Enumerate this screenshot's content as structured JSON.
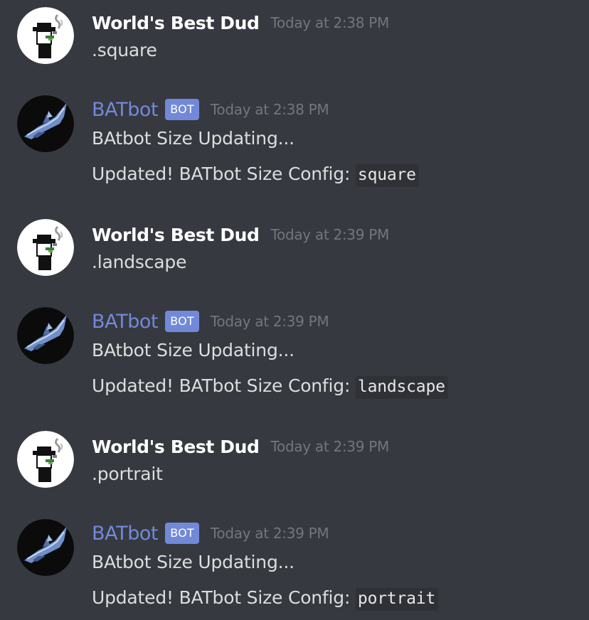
{
  "messages": [
    {
      "author": "World's Best Dud",
      "is_bot": false,
      "avatar_icon": "hat-smoker-avatar",
      "timestamp": "Today at 2:38 PM",
      "lines": [
        ".square"
      ]
    },
    {
      "author": "BATbot",
      "is_bot": true,
      "bot_tag": "BOT",
      "avatar_icon": "bat-avatar",
      "timestamp": "Today at 2:38 PM",
      "lines": [
        "BAtbot Size Updating..."
      ],
      "config_prefix": "Updated! BATbot Size Config: ",
      "config_value": "square"
    },
    {
      "author": "World's Best Dud",
      "is_bot": false,
      "avatar_icon": "hat-smoker-avatar",
      "timestamp": "Today at 2:39 PM",
      "lines": [
        ".landscape"
      ]
    },
    {
      "author": "BATbot",
      "is_bot": true,
      "bot_tag": "BOT",
      "avatar_icon": "bat-avatar",
      "timestamp": "Today at 2:39 PM",
      "lines": [
        "BAtbot Size Updating..."
      ],
      "config_prefix": "Updated! BATbot Size Config: ",
      "config_value": "landscape"
    },
    {
      "author": "World's Best Dud",
      "is_bot": false,
      "avatar_icon": "hat-smoker-avatar",
      "timestamp": "Today at 2:39 PM",
      "lines": [
        ".portrait"
      ]
    },
    {
      "author": "BATbot",
      "is_bot": true,
      "bot_tag": "BOT",
      "avatar_icon": "bat-avatar",
      "timestamp": "Today at 2:39 PM",
      "lines": [
        "BAtbot Size Updating..."
      ],
      "config_prefix": "Updated! BATbot Size Config: ",
      "config_value": "portrait"
    }
  ],
  "colors": {
    "background": "#36393f",
    "username_user": "#ffffff",
    "username_bot": "#7289da",
    "bot_tag_bg": "#7289da",
    "timestamp": "#72767d",
    "text": "#dcddde",
    "code_bg": "#2f3136"
  }
}
